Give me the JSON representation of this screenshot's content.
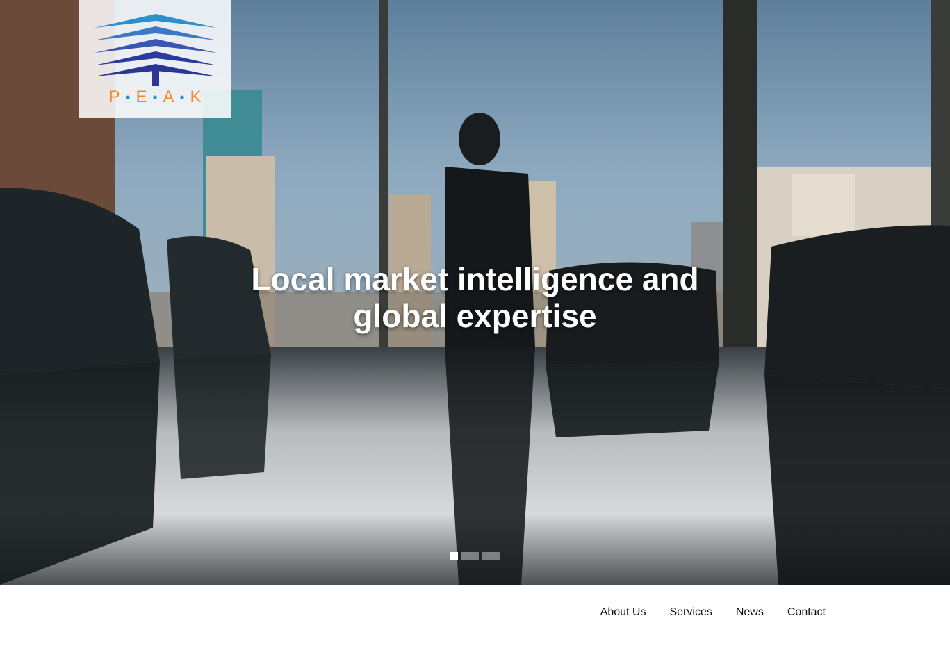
{
  "hero": {
    "headline_line1": "Local market intelligence and",
    "headline_line2": "global expertise",
    "slides": [
      {
        "active": true
      },
      {
        "active": false
      },
      {
        "active": false
      }
    ]
  },
  "logo": {
    "letters": [
      "P",
      "E",
      "A",
      "K"
    ],
    "letter_color": "#f0872a",
    "dot_color": "#2a8fd0",
    "roof_colors": [
      "#2e8fcf",
      "#3a62b8",
      "#2c3a9e"
    ]
  },
  "nav": {
    "items": [
      {
        "label": "About Us"
      },
      {
        "label": "Services"
      },
      {
        "label": "News"
      },
      {
        "label": "Contact"
      }
    ]
  }
}
